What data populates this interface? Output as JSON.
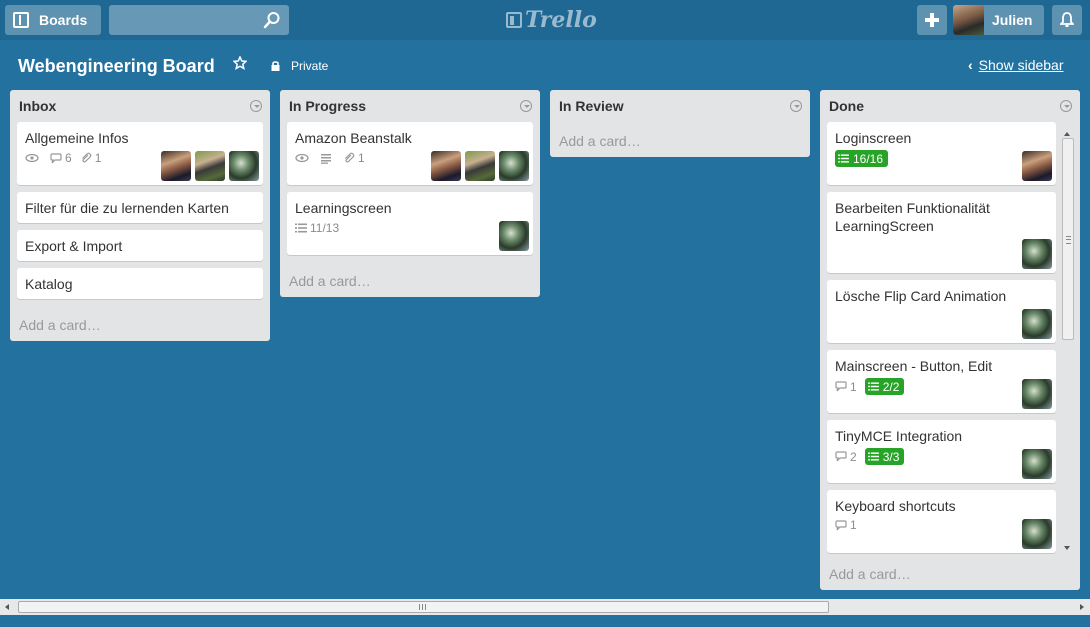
{
  "topbar": {
    "boards_label": "Boards",
    "search_placeholder": "",
    "logo_text": "Trello",
    "user_name": "Julien"
  },
  "board": {
    "title": "Webengineering Board",
    "visibility": "Private",
    "show_sidebar_label": "Show sidebar"
  },
  "lists": [
    {
      "name": "Inbox",
      "add_card": "Add a card…",
      "cards": [
        {
          "title": "Allgemeine Infos",
          "comments": "6",
          "attachments": "1",
          "members": [
            "julien",
            "glasses",
            "tree"
          ]
        },
        {
          "title": "Filter für die zu lernenden Karten"
        },
        {
          "title": "Export & Import"
        },
        {
          "title": "Katalog"
        }
      ]
    },
    {
      "name": "In Progress",
      "add_card": "Add a card…",
      "cards": [
        {
          "title": "Amazon Beanstalk",
          "attachments": "1",
          "members": [
            "julien",
            "glasses",
            "tree"
          ]
        },
        {
          "title": "Learningscreen",
          "checklist": "11/13",
          "members": [
            "tree"
          ]
        }
      ]
    },
    {
      "name": "In Review",
      "add_card": "Add a card…",
      "cards": []
    },
    {
      "name": "Done",
      "add_card": "Add a card…",
      "cards": [
        {
          "title": "Loginscreen",
          "checklist": "16/16",
          "members": [
            "julien"
          ]
        },
        {
          "title": "Bearbeiten Funktionalität LearningScreen",
          "members": [
            "tree"
          ]
        },
        {
          "title": "Lösche Flip Card Animation",
          "members": [
            "tree"
          ]
        },
        {
          "title": "Mainscreen - Button, Edit",
          "comments": "1",
          "checklist": "2/2",
          "members": [
            "tree"
          ]
        },
        {
          "title": "TinyMCE Integration",
          "comments": "2",
          "checklist": "3/3",
          "members": [
            "tree"
          ]
        },
        {
          "title": "Keyboard shortcuts",
          "comments": "1",
          "members": [
            "tree"
          ]
        }
      ]
    }
  ],
  "colors": {
    "board_bg": "#23719f",
    "header_bg": "#1f6894",
    "list_bg": "#e2e4e6",
    "complete_badge": "#27a327"
  },
  "icons": {
    "boards": "boards-icon",
    "search": "search-icon",
    "add": "plus-icon",
    "notifications": "bell-icon",
    "star": "star-icon",
    "lock": "lock-icon",
    "list_menu": "chevron-down-circle-icon",
    "watch": "eye-icon",
    "comment": "comment-icon",
    "attachment": "paperclip-icon",
    "description": "description-icon",
    "checklist": "checklist-icon"
  }
}
